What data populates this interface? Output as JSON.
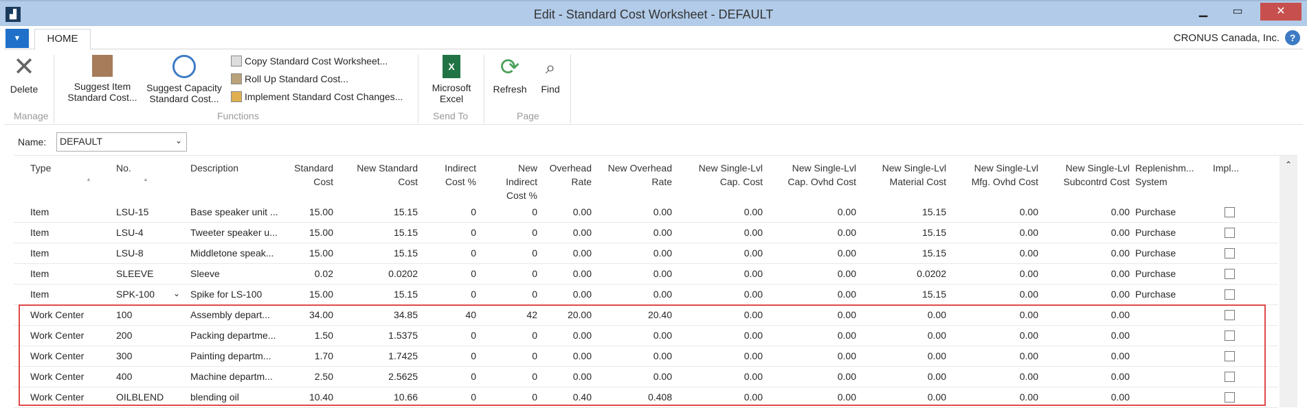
{
  "window": {
    "title": "Edit - Standard Cost Worksheet - DEFAULT",
    "company": "CRONUS Canada, Inc."
  },
  "ribbon": {
    "tab": "HOME",
    "delete": "Delete",
    "suggest_item": [
      "Suggest Item",
      "Standard Cost..."
    ],
    "suggest_capacity": [
      "Suggest Capacity",
      "Standard Cost..."
    ],
    "copy": "Copy Standard Cost Worksheet...",
    "rollup": "Roll Up Standard Cost...",
    "implement": "Implement Standard Cost Changes...",
    "excel": [
      "Microsoft",
      "Excel"
    ],
    "refresh": "Refresh",
    "find": "Find",
    "groups": {
      "manage": "Manage",
      "functions": "Functions",
      "send_to": "Send To",
      "page": "Page"
    }
  },
  "name_field": {
    "label": "Name:",
    "value": "DEFAULT"
  },
  "columns": [
    [
      "Type"
    ],
    [
      "No."
    ],
    [
      "Description"
    ],
    [
      "Standard",
      "Cost"
    ],
    [
      "New Standard",
      "Cost"
    ],
    [
      "Indirect",
      "Cost %"
    ],
    [
      "New",
      "Indirect",
      "Cost %"
    ],
    [
      "Overhead",
      "Rate"
    ],
    [
      "New Overhead",
      "Rate"
    ],
    [
      "New Single-Lvl",
      "Cap. Cost"
    ],
    [
      "New Single-Lvl",
      "Cap. Ovhd Cost"
    ],
    [
      "New Single-Lvl",
      "Material Cost"
    ],
    [
      "New Single-Lvl",
      "Mfg. Ovhd Cost"
    ],
    [
      "New Single-Lvl",
      "Subcontrd Cost"
    ],
    [
      "Replenishm...",
      "System"
    ],
    [
      "Impl..."
    ]
  ],
  "rows": [
    [
      "Item",
      "LSU-15",
      "Base speaker unit ...",
      "15.00",
      "15.15",
      "0",
      "0",
      "0.00",
      "0.00",
      "0.00",
      "0.00",
      "15.15",
      "0.00",
      "0.00",
      "Purchase"
    ],
    [
      "Item",
      "LSU-4",
      "Tweeter speaker u...",
      "15.00",
      "15.15",
      "0",
      "0",
      "0.00",
      "0.00",
      "0.00",
      "0.00",
      "15.15",
      "0.00",
      "0.00",
      "Purchase"
    ],
    [
      "Item",
      "LSU-8",
      "Middletone speak...",
      "15.00",
      "15.15",
      "0",
      "0",
      "0.00",
      "0.00",
      "0.00",
      "0.00",
      "15.15",
      "0.00",
      "0.00",
      "Purchase"
    ],
    [
      "Item",
      "SLEEVE",
      "Sleeve",
      "0.02",
      "0.0202",
      "0",
      "0",
      "0.00",
      "0.00",
      "0.00",
      "0.00",
      "0.0202",
      "0.00",
      "0.00",
      "Purchase"
    ],
    [
      "Item",
      "SPK-100",
      "Spike for LS-100",
      "15.00",
      "15.15",
      "0",
      "0",
      "0.00",
      "0.00",
      "0.00",
      "0.00",
      "15.15",
      "0.00",
      "0.00",
      "Purchase"
    ],
    [
      "Work Center",
      "100",
      "Assembly depart...",
      "34.00",
      "34.85",
      "40",
      "42",
      "20.00",
      "20.40",
      "0.00",
      "0.00",
      "0.00",
      "0.00",
      "0.00",
      ""
    ],
    [
      "Work Center",
      "200",
      "Packing departme...",
      "1.50",
      "1.5375",
      "0",
      "0",
      "0.00",
      "0.00",
      "0.00",
      "0.00",
      "0.00",
      "0.00",
      "0.00",
      ""
    ],
    [
      "Work Center",
      "300",
      "Painting departm...",
      "1.70",
      "1.7425",
      "0",
      "0",
      "0.00",
      "0.00",
      "0.00",
      "0.00",
      "0.00",
      "0.00",
      "0.00",
      ""
    ],
    [
      "Work Center",
      "400",
      "Machine departm...",
      "2.50",
      "2.5625",
      "0",
      "0",
      "0.00",
      "0.00",
      "0.00",
      "0.00",
      "0.00",
      "0.00",
      "0.00",
      ""
    ],
    [
      "Work Center",
      "OILBLEND",
      "blending oil",
      "10.40",
      "10.66",
      "0",
      "0",
      "0.40",
      "0.408",
      "0.00",
      "0.00",
      "0.00",
      "0.00",
      "0.00",
      ""
    ]
  ],
  "colors": {
    "accent": "#1e70c8",
    "highlight": "#e04848",
    "titlebar": "#b1cbe8"
  }
}
